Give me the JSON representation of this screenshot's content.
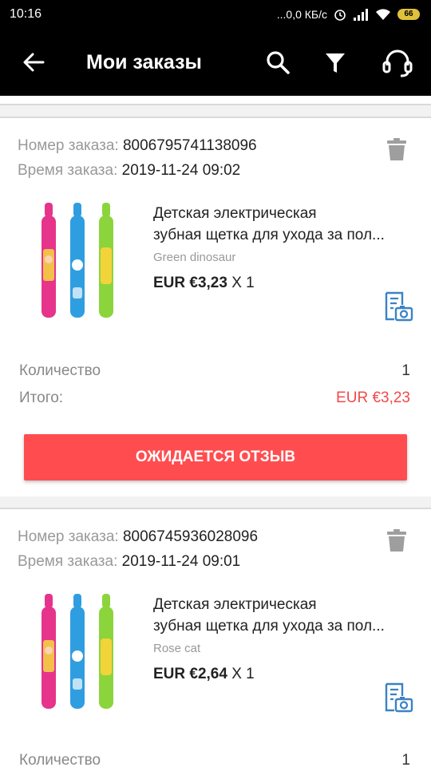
{
  "status_bar": {
    "time": "10:16",
    "network_speed": "...0,0 КБ/с",
    "battery": "66",
    "icons": [
      "alarm-icon",
      "signal-icon",
      "wifi-icon",
      "battery-icon"
    ]
  },
  "app_bar": {
    "title": "Мои заказы",
    "icons": [
      "back-arrow-icon",
      "search-icon",
      "filter-icon",
      "support-headset-icon"
    ]
  },
  "orders": [
    {
      "order_label": "Номер заказа:",
      "order_number": "8006795741138096",
      "time_label": "Время заказа:",
      "time_value": "2019-11-24 09:02",
      "product_title": "Детская электрическая зубная щетка для ухода за пол...",
      "product_title_line1": "Детская электрическая",
      "product_title_line2": "зубная щетка для ухода за пол...",
      "variant": "Green  dinosaur",
      "price": "EUR €3,23",
      "multiplier": "X 1",
      "quantity_label": "Количество",
      "quantity_value": "1",
      "total_label": "Итого:",
      "total_value": "EUR €3,23",
      "action_label": "ОЖИДАЕТСЯ ОТЗЫВ"
    },
    {
      "order_label": "Номер заказа:",
      "order_number": "8006745936028096",
      "time_label": "Время заказа:",
      "time_value": "2019-11-24 09:01",
      "product_title_line1": "Детская электрическая",
      "product_title_line2": "зубная щетка для ухода за пол...",
      "variant": "Rose cat",
      "price": "EUR €2,64",
      "multiplier": "X 1",
      "quantity_label": "Количество",
      "quantity_value": "1"
    }
  ],
  "colors": {
    "accent": "#ff4d4f",
    "total_price": "#f04a4a",
    "icon_blue": "#3b82c4",
    "trash_gray": "#9e9e9e"
  }
}
